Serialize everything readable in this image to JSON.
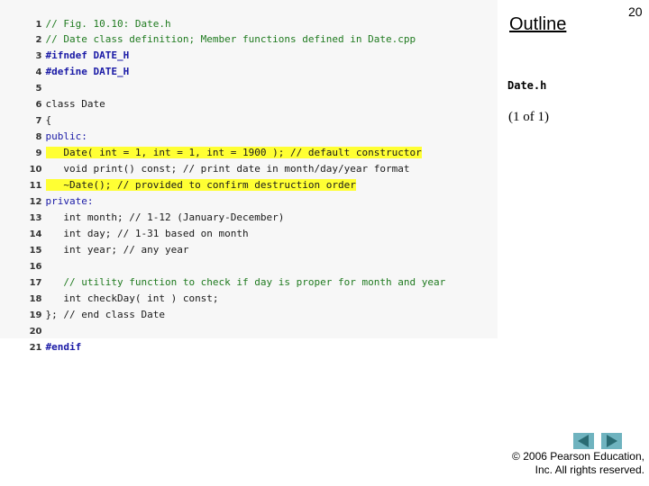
{
  "slide": {
    "page_number": "20",
    "outline_title": "Outline",
    "file_name": "Date.h",
    "page_of": "(1 of 1)",
    "copyright_line1": "© 2006 Pearson Education,",
    "copyright_line2": "Inc.  All rights reserved.",
    "nav": {
      "prev_icon": "previous-arrow-icon",
      "next_icon": "next-arrow-icon",
      "button_color": "#6fb3bf",
      "arrow_color": "#2a6b73"
    }
  },
  "code": {
    "highlight_color": "#ffff33",
    "lines": [
      {
        "n": "1",
        "text": "// Fig. 10.10: Date.h"
      },
      {
        "n": "2",
        "text": "// Date class definition; Member functions defined in Date.cpp"
      },
      {
        "n": "3",
        "text": "#ifndef DATE_H"
      },
      {
        "n": "4",
        "text": "#define DATE_H"
      },
      {
        "n": "5",
        "text": ""
      },
      {
        "n": "6",
        "text": "class Date"
      },
      {
        "n": "7",
        "text": "{"
      },
      {
        "n": "8",
        "text": "public:"
      },
      {
        "n": "9",
        "text": "   Date( int = 1, int = 1, int = 1900 ); // default constructor",
        "highlight": true
      },
      {
        "n": "10",
        "text": "   void print() const; // print date in month/day/year format"
      },
      {
        "n": "11",
        "text": "   ~Date(); // provided to confirm destruction order",
        "highlight": true
      },
      {
        "n": "12",
        "text": "private:"
      },
      {
        "n": "13",
        "text": "   int month; // 1-12 (January-December)"
      },
      {
        "n": "14",
        "text": "   int day; // 1-31 based on month"
      },
      {
        "n": "15",
        "text": "   int year; // any year"
      },
      {
        "n": "16",
        "text": ""
      },
      {
        "n": "17",
        "text": "   // utility function to check if day is proper for month and year"
      },
      {
        "n": "18",
        "text": "   int checkDay( int ) const;"
      },
      {
        "n": "19",
        "text": "}; // end class Date"
      },
      {
        "n": "20",
        "text": ""
      },
      {
        "n": "21",
        "text": "#endif"
      }
    ]
  }
}
